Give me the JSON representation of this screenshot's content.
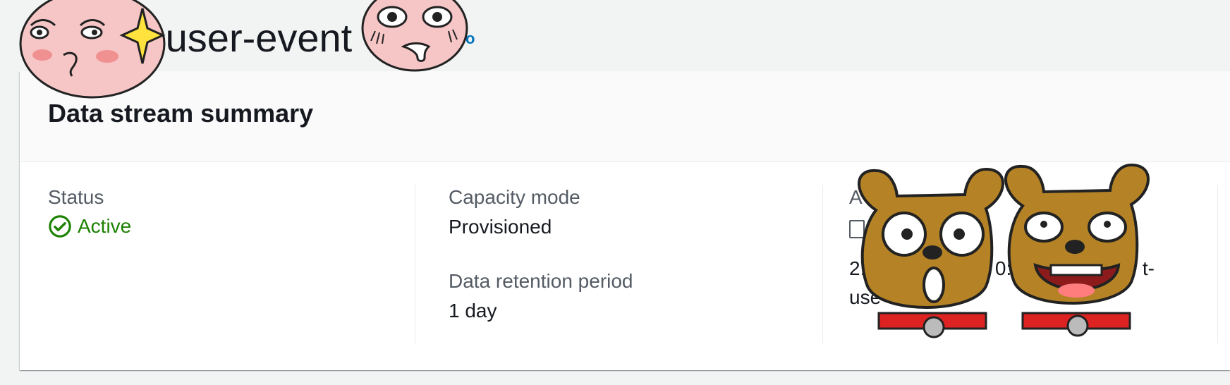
{
  "page": {
    "title_visible": "-user-event",
    "info_link": "o"
  },
  "summary": {
    "title": "Data stream summary",
    "status": {
      "label": "Status",
      "value": "Active"
    },
    "capacity_mode": {
      "label": "Capacity mode",
      "value": "Provisioned"
    },
    "retention": {
      "label": "Data retention period",
      "value": "1 day"
    },
    "arn": {
      "label_partial": "A",
      "line1_a": "2:",
      "line1_b": "0:",
      "line1_c": "t-",
      "line2": "use"
    }
  },
  "colors": {
    "active_green": "#1d8102",
    "link_blue": "#0073bb",
    "bg": "#f2f3f3"
  },
  "icons": {
    "status": "check-circle-icon",
    "copy": "copy-icon"
  }
}
